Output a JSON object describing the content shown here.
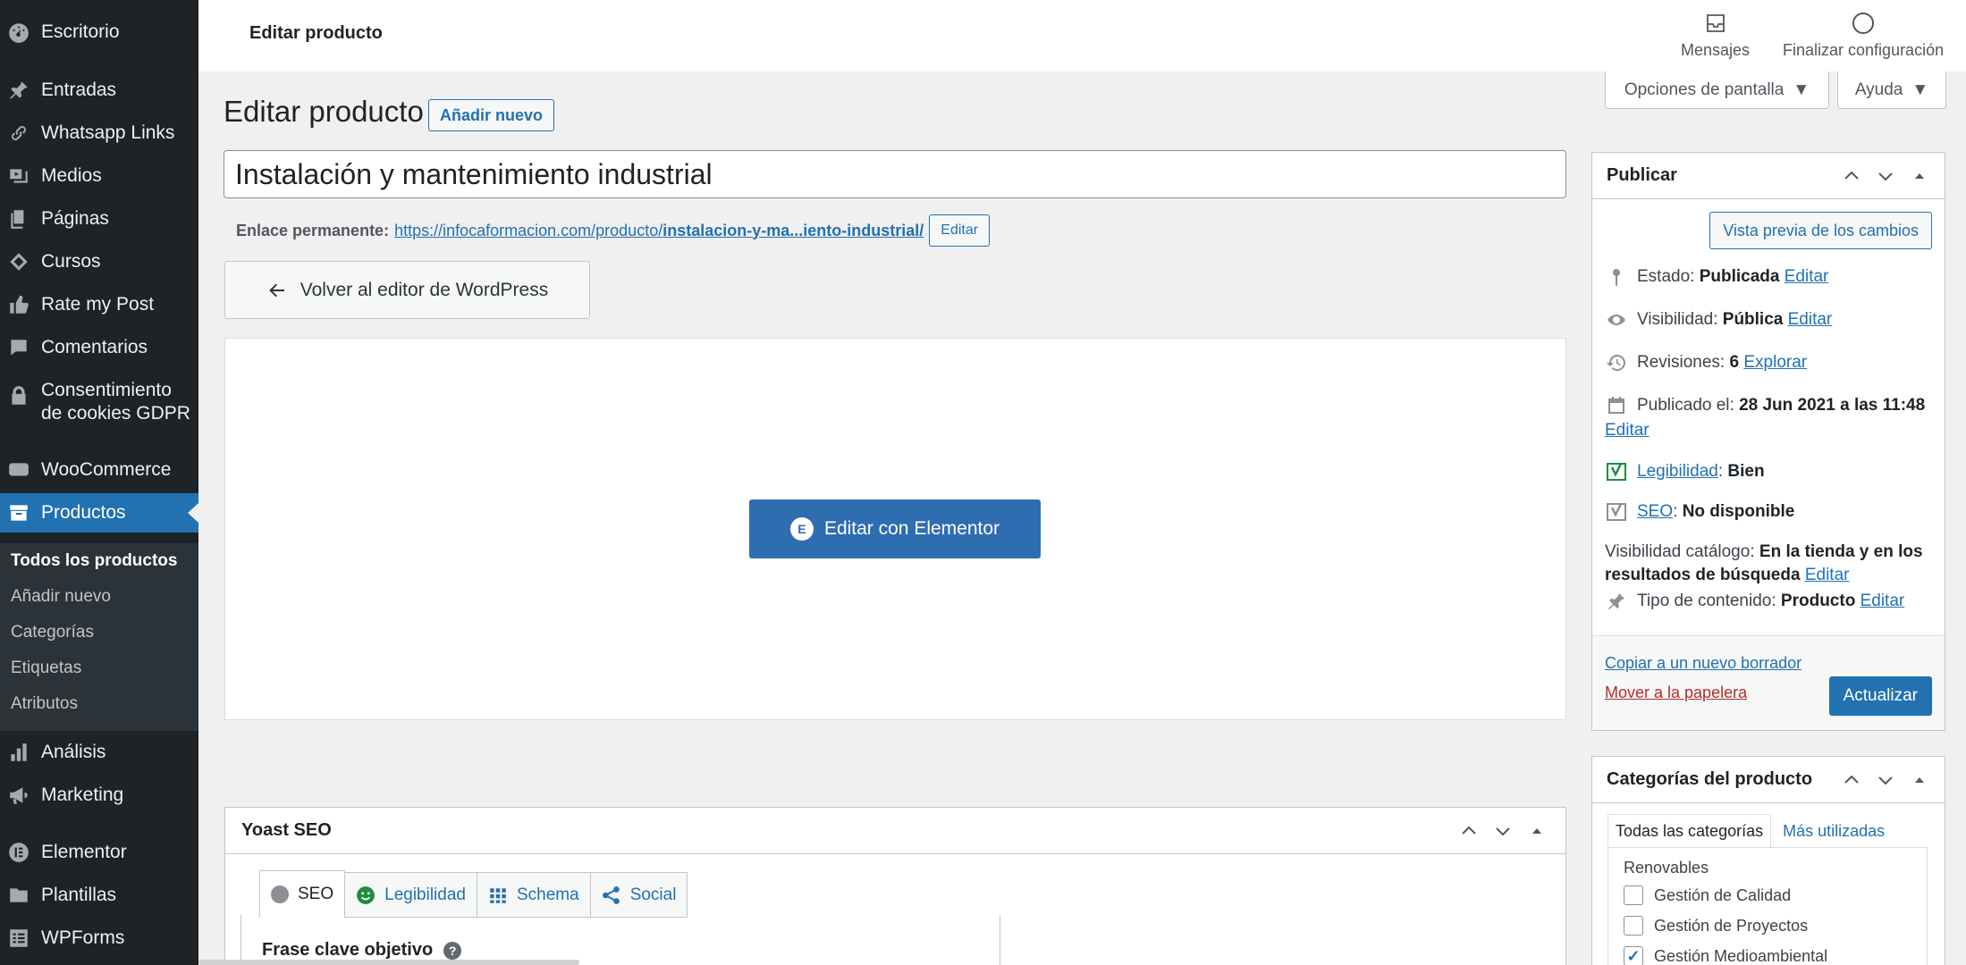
{
  "sidebar": {
    "items": [
      {
        "label": "Escritorio",
        "icon": "dashboard-icon"
      },
      {
        "label": "Entradas",
        "icon": "pin-icon"
      },
      {
        "label": "Whatsapp Links",
        "icon": "link-icon"
      },
      {
        "label": "Medios",
        "icon": "media-icon"
      },
      {
        "label": "Páginas",
        "icon": "pages-icon"
      },
      {
        "label": "Cursos",
        "icon": "courses-icon"
      },
      {
        "label": "Rate my Post",
        "icon": "thumbs-up-icon"
      },
      {
        "label": "Comentarios",
        "icon": "comment-icon"
      },
      {
        "label": "Consentimiento de cookies GDPR",
        "icon": "lock-icon"
      },
      {
        "label": "WooCommerce",
        "icon": "woocommerce-icon"
      },
      {
        "label": "Productos",
        "icon": "archive-icon"
      },
      {
        "label": "Análisis",
        "icon": "chart-bar-icon"
      },
      {
        "label": "Marketing",
        "icon": "megaphone-icon"
      },
      {
        "label": "Elementor",
        "icon": "elementor-icon"
      },
      {
        "label": "Plantillas",
        "icon": "folder-icon"
      },
      {
        "label": "WPForms",
        "icon": "forms-icon"
      }
    ],
    "submenu": [
      "Todos los productos",
      "Añadir nuevo",
      "Categorías",
      "Etiquetas",
      "Atributos"
    ]
  },
  "topbar": {
    "title": "Editar producto",
    "messages_label": "Mensajes",
    "finish_label": "Finalizar configuración"
  },
  "screen_options": {
    "label": "Opciones de pantalla",
    "help": "Ayuda"
  },
  "heading": {
    "title": "Editar producto",
    "add_new": "Añadir nuevo"
  },
  "product": {
    "title": "Instalación y mantenimiento industrial",
    "permalink_label": "Enlace permanente:",
    "permalink_base": "https://infocaformacion.com/producto/",
    "permalink_slug": "instalacion-y-ma...iento-industrial/",
    "permalink_edit": "Editar"
  },
  "editor": {
    "back_label": "Volver al editor de WordPress",
    "elementor_label": "Editar con Elementor",
    "elementor_logo": "E"
  },
  "yoast": {
    "title": "Yoast SEO",
    "tabs": [
      {
        "label": "SEO",
        "icon": "gray-dot-icon"
      },
      {
        "label": "Legibilidad",
        "icon": "smiley-icon"
      },
      {
        "label": "Schema",
        "icon": "grid-icon"
      },
      {
        "label": "Social",
        "icon": "share-icon"
      }
    ],
    "focus_label": "Frase clave objetivo",
    "help_glyph": "?"
  },
  "publish": {
    "title": "Publicar",
    "preview": "Vista previa de los cambios",
    "status_label": "Estado:",
    "status_value": "Publicada",
    "status_edit": "Editar",
    "visibility_label": "Visibilidad:",
    "visibility_value": "Pública",
    "visibility_edit": "Editar",
    "revisions_label": "Revisiones:",
    "revisions_value": "6",
    "revisions_link": "Explorar",
    "published_label": "Publicado el:",
    "published_value": "28 Jun 2021 a las 11:48",
    "published_edit": "Editar",
    "readability_link": "Legibilidad",
    "readability_value": "Bien",
    "seo_link": "SEO",
    "seo_value": "No disponible",
    "catalog_label": "Visibilidad catálogo:",
    "catalog_value": "En la tienda y en los resultados de búsqueda",
    "catalog_edit": "Editar",
    "content_type_label": "Tipo de contenido:",
    "content_type_value": "Producto",
    "content_type_edit": "Editar",
    "copy_draft": "Copiar a un nuevo borrador",
    "trash": "Mover a la papelera",
    "update": "Actualizar"
  },
  "categories": {
    "title": "Categorías del producto",
    "tab_all": "Todas las categorías",
    "tab_used": "Más utilizadas",
    "group": "Renovables",
    "items": [
      {
        "label": "Gestión de Calidad",
        "checked": false
      },
      {
        "label": "Gestión de Proyectos",
        "checked": false
      },
      {
        "label": "Gestión Medioambiental",
        "checked": true
      }
    ],
    "check_glyph": "✓"
  },
  "colors": {
    "admin_blue": "#2271b1",
    "sidebar_bg": "#1d2327",
    "elementor_blue": "#2f6db1",
    "yoast_green": "#1e8c3a"
  }
}
